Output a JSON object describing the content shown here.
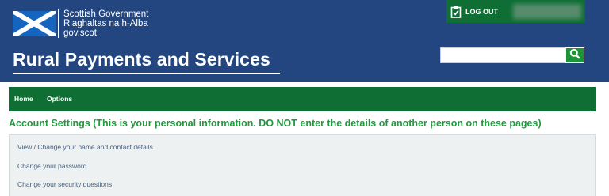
{
  "header": {
    "org_line1": "Scottish Government",
    "org_line2": "Riaghaltas na h-Alba",
    "org_line3": "gov.scot",
    "app_title": "Rural Payments and Services",
    "logout_label": "LOG OUT",
    "search_value": ""
  },
  "nav": {
    "items": [
      "Home",
      "Options"
    ]
  },
  "main": {
    "heading": "Account Settings (This is your personal information. DO NOT enter the details of another person on these pages)",
    "links": [
      "View / Change your name and contact details",
      "Change your password",
      "Change your security questions"
    ]
  },
  "colors": {
    "header_bg": "#234680",
    "green_dark": "#0e6e34",
    "heading_green": "#1f9a3d",
    "panel_bg": "#eef1f2"
  },
  "icons": [
    "saltire-flag-icon",
    "clipboard-check-icon",
    "search-icon"
  ]
}
